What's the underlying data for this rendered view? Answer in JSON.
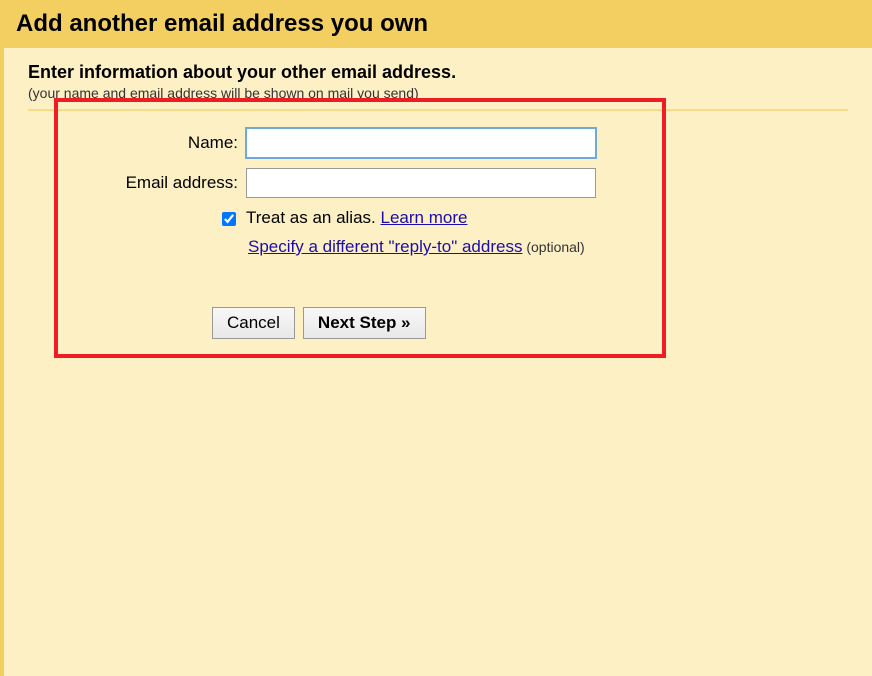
{
  "header": {
    "title": "Add another email address you own"
  },
  "content": {
    "subtitle": "Enter information about your other email address.",
    "subtext": "(your name and email address will be shown on mail you send)"
  },
  "form": {
    "name_label": "Name:",
    "name_value": "",
    "email_label": "Email address:",
    "email_value": "",
    "alias_checked": true,
    "alias_text": "Treat as an alias. ",
    "alias_learn_more": "Learn more",
    "reply_to_link": "Specify a different \"reply-to\" address",
    "reply_to_optional": " (optional)"
  },
  "buttons": {
    "cancel": "Cancel",
    "next": "Next Step »"
  }
}
